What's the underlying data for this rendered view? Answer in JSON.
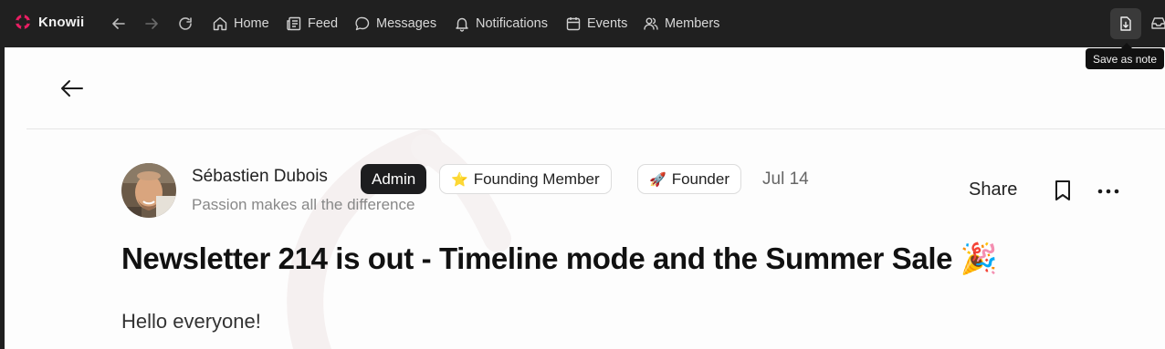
{
  "app": {
    "name": "Knowii",
    "brand_color": "#e91e63"
  },
  "nav": {
    "back_icon": "arrow-left-icon",
    "forward_icon": "arrow-right-icon",
    "reload_icon": "reload-icon",
    "items": [
      {
        "label": "Home",
        "icon": "home-icon"
      },
      {
        "label": "Feed",
        "icon": "newspaper-icon"
      },
      {
        "label": "Messages",
        "icon": "chat-bubble-icon"
      },
      {
        "label": "Notifications",
        "icon": "bell-icon"
      },
      {
        "label": "Events",
        "icon": "calendar-icon"
      },
      {
        "label": "Members",
        "icon": "users-icon"
      }
    ]
  },
  "toolbar": {
    "tooltip": "Save as note",
    "save_icon": "save-note-icon"
  },
  "post": {
    "author": {
      "name": "Sébastien Dubois",
      "tagline": "Passion makes all the difference"
    },
    "badges": [
      {
        "label": "Admin",
        "emoji": ""
      },
      {
        "label": "Founding Member",
        "emoji": "⭐"
      },
      {
        "label": "Founder",
        "emoji": "🚀"
      }
    ],
    "date": "Jul 14",
    "actions": {
      "share_label": "Share",
      "bookmark_icon": "bookmark-icon",
      "more_icon": "more-horizontal-icon"
    },
    "title": "Newsletter 214 is out - Timeline mode and the Summer Sale 🎉",
    "body_first_line": "Hello everyone!"
  }
}
